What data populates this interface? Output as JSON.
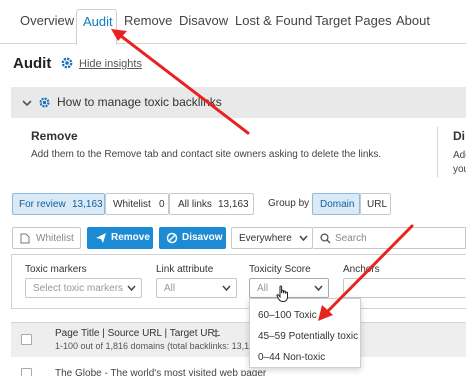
{
  "nav": {
    "tabs": [
      {
        "label": "Overview"
      },
      {
        "label": "Audit"
      },
      {
        "label": "Remove"
      },
      {
        "label": "Disavow"
      },
      {
        "label": "Lost & Found"
      },
      {
        "label": "Target Pages"
      },
      {
        "label": "About"
      }
    ]
  },
  "header": {
    "title": "Audit",
    "hide_insights": "Hide insights"
  },
  "insights": {
    "bar_label": "How to manage toxic backlinks",
    "remove_title": "Remove",
    "remove_text": "Add them to the Remove tab and contact site owners asking to delete the links.",
    "disavow_title": "Di",
    "disavow_text_1": "Add",
    "disavow_text_2": "you"
  },
  "filters": {
    "segments": [
      {
        "label": "For review",
        "count": "13,163"
      },
      {
        "label": "Whitelist",
        "count": "0"
      },
      {
        "label": "All links",
        "count": "13,163"
      }
    ],
    "group_by_label": "Group by",
    "group_by": [
      "Domain",
      "URL"
    ]
  },
  "actions": {
    "whitelist": "Whitelist",
    "remove": "Remove",
    "disavow": "Disavow",
    "scope": "Everywhere",
    "search_placeholder": "Search"
  },
  "filter_panel": {
    "toxic_markers_label": "Toxic markers",
    "toxic_markers_placeholder": "Select toxic markers",
    "link_attribute_label": "Link attribute",
    "link_attribute_value": "All",
    "toxicity_label": "Toxicity Score",
    "toxicity_value": "All",
    "anchors_label": "Anchors"
  },
  "toxicity_options": [
    "60–100 Toxic",
    "45–59 Potentially toxic",
    "0–44 Non-toxic"
  ],
  "table": {
    "header": "Page Title | Source URL | Target URL",
    "summary": "1-100 out of 1,816 domains (total backlinks: 13,16",
    "first_row": "The Globe - The world's most visited web pager"
  },
  "colors": {
    "accent": "#1d8bd4",
    "annotation": "#e8231f"
  }
}
